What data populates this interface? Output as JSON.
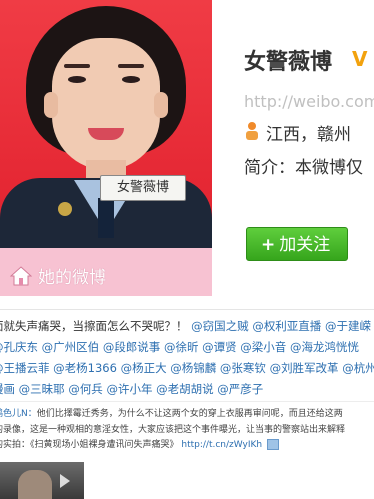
{
  "profile": {
    "photo_name_tag": "女警薇博",
    "weibo_link": "她的微博",
    "nickname": "女警薇博",
    "verify_mark": "V",
    "url": "http://weibo.com",
    "location": "江西，赣州",
    "bio": "简介：本微博仅",
    "follow_button": {
      "plus": "+",
      "label": "加关注"
    }
  },
  "tweet1": {
    "lines": [
      [
        "面就失声痛哭，当擦面怎么不哭呢？！",
        "@窃国之贼",
        "@权利亚直播",
        "@于建嵘"
      ],
      [
        "@孔庆东",
        "@广州区伯",
        "@段郎说事",
        "@徐昕",
        "@谭贤",
        "@梁小音",
        "@海龙鸿恍恍"
      ],
      [
        "@王播云菲",
        "@老杨1366",
        "@杨正大",
        "@杨锦麟",
        "@张寒钦",
        "@刘胜军改革",
        "@杭州质"
      ],
      [
        "漫画",
        "@三昧耶",
        "@何兵",
        "@许小年",
        "@老胡胡说",
        "@严彦子"
      ]
    ]
  },
  "tweet2": {
    "author": "鹤色儿N：",
    "line1": "他们比擇霉迁秀务，为什么不让这两个女的穿上衣服再审问呢，而且还给这两",
    "line2": "的录像，这是一种观相的意淫女性，大家应该把这个事件曝光，让当事的警察站出来解释",
    "line3_prefix": "的实拍：《扫黄现场小姐裸身遭讯问失声痛哭》",
    "short_link": "http://t.cn/zWyIKh"
  },
  "colors": {
    "photo_bg": "#e92e3c",
    "photo_footer": "#f7c2d2",
    "follow_green": "#3fb024",
    "link_blue": "#2d6fb0",
    "verify_orange": "#f2a20e"
  },
  "icons": [
    "home-icon",
    "verified-icon",
    "person-icon",
    "video-icon",
    "play-icon"
  ]
}
